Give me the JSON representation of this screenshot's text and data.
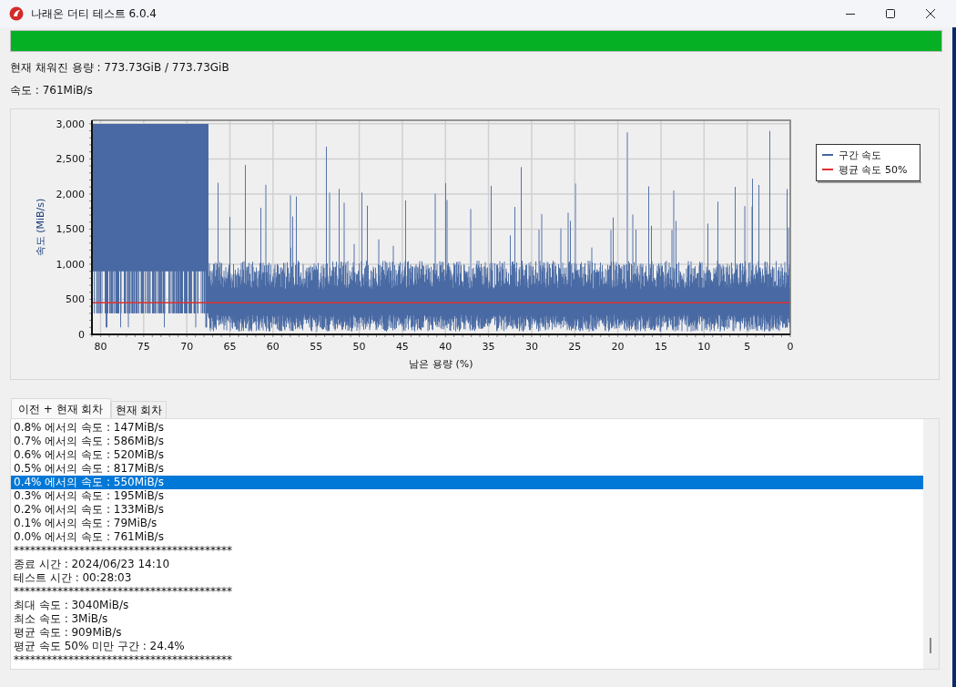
{
  "window": {
    "title": "나래온 더티 테스트 6.0.4"
  },
  "progress": {
    "level": 1
  },
  "capacity": "현재 채워진 용량 : 773.73GiB / 773.73GiB",
  "speed": "속도 : 761MiB/s",
  "chart": {
    "chart_data": {
      "type": "line",
      "xlabel": "남은 용량 (%)",
      "ylabel": "속도 (MiB/s)",
      "xlim": [
        81,
        0
      ],
      "ylim": [
        0,
        3050
      ],
      "xticks": [
        80,
        75,
        70,
        65,
        60,
        55,
        50,
        45,
        40,
        35,
        30,
        25,
        20,
        15,
        10,
        5,
        0
      ],
      "yticks": [
        {
          "value": 0,
          "label": "0"
        },
        {
          "value": 500,
          "label": "500"
        },
        {
          "value": 1000,
          "label": "1,000"
        },
        {
          "value": 1500,
          "label": "1,500"
        },
        {
          "value": 2000,
          "label": "2,000"
        },
        {
          "value": 2500,
          "label": "2,500"
        },
        {
          "value": 3000,
          "label": "3,000"
        }
      ],
      "x": [
        81,
        0
      ],
      "grid": true,
      "series": [
        {
          "name": "평균 속도 50%",
          "color": "#e03030",
          "values": [
            450,
            450
          ]
        }
      ]
    },
    "legend": [
      {
        "label": "구간 속도",
        "color": "#4465a0"
      }
    ]
  },
  "tabs": [
    {
      "label": "이전 + 현재 회차",
      "selected": true
    },
    {
      "label": "현재 회차",
      "selected": false
    }
  ],
  "log": {
    "lines": [
      {
        "text": "0.8% 에서의 속도 : 147MiB/s",
        "selected": false
      },
      {
        "text": "0.7% 에서의 속도 : 586MiB/s",
        "selected": false
      },
      {
        "text": "0.6% 에서의 속도 : 520MiB/s",
        "selected": false
      },
      {
        "text": "0.5% 에서의 속도 : 817MiB/s",
        "selected": false
      },
      {
        "text": "0.4% 에서의 속도 : 550MiB/s",
        "selected": true
      },
      {
        "text": "0.3% 에서의 속도 : 195MiB/s",
        "selected": false
      },
      {
        "text": "0.2% 에서의 속도 : 133MiB/s",
        "selected": false
      },
      {
        "text": "0.1% 에서의 속도 : 79MiB/s",
        "selected": false
      },
      {
        "text": "0.0% 에서의 속도 : 761MiB/s",
        "selected": false
      },
      {
        "text": "****************************************",
        "selected": false
      },
      {
        "text": "종료 시간 : 2024/06/23 14:10",
        "selected": false
      },
      {
        "text": "테스트 시간 : 00:28:03",
        "selected": false
      },
      {
        "text": "****************************************",
        "selected": false
      },
      {
        "text": "최대 속도 : 3040MiB/s",
        "selected": false
      },
      {
        "text": "최소 속도 : 3MiB/s",
        "selected": false
      },
      {
        "text": "평균 속도 : 909MiB/s",
        "selected": false
      },
      {
        "text": "평균 속도 50% 미만 구간 : 24.4%",
        "selected": false
      },
      {
        "text": "****************************************",
        "selected": false
      }
    ]
  }
}
